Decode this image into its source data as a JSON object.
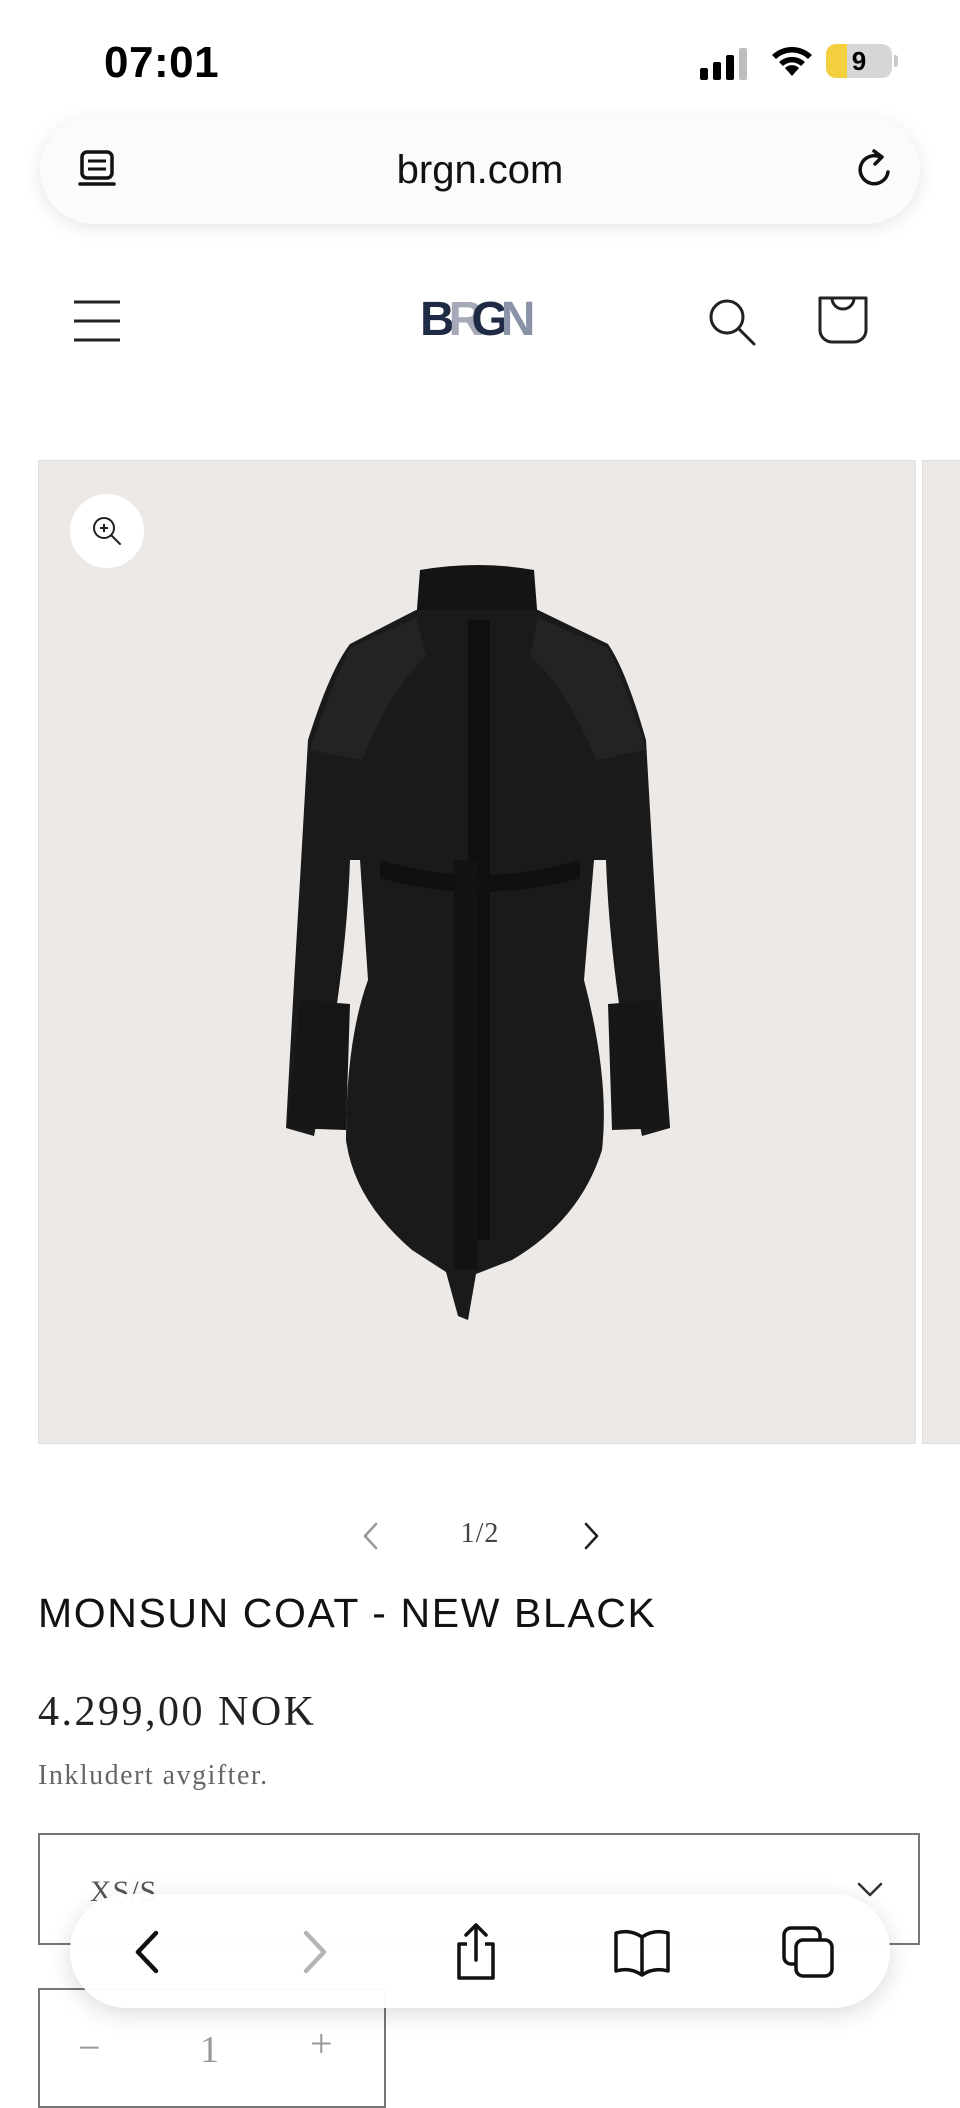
{
  "status_bar": {
    "time": "07:01",
    "battery_level": "9"
  },
  "browser": {
    "url": "brgn.com"
  },
  "site": {
    "logo_letters": [
      "B",
      "R",
      "G",
      "N"
    ]
  },
  "product": {
    "image_index": "1/2",
    "title": "MONSUN COAT - NEW BLACK",
    "price": "4.299,00 NOK",
    "tax_note": "Inkludert avgifter.",
    "size_selected": "XS/S",
    "quantity": "1",
    "quantity_minus": "−",
    "quantity_plus": "+"
  },
  "colors": {
    "logo_dark": "#1f2a44",
    "logo_light": "#a6aab8",
    "media_background": "#ece9e6",
    "battery_fill": "#f4d03f"
  },
  "icons": {
    "address_left": "reader-icon",
    "address_right": "reload-icon",
    "menu": "hamburger-menu-icon",
    "search": "search-icon",
    "cart": "cart-icon",
    "zoom": "zoom-in-icon",
    "toolbar": [
      "back-icon",
      "forward-icon",
      "share-icon",
      "bookmarks-icon",
      "tabs-icon"
    ]
  }
}
